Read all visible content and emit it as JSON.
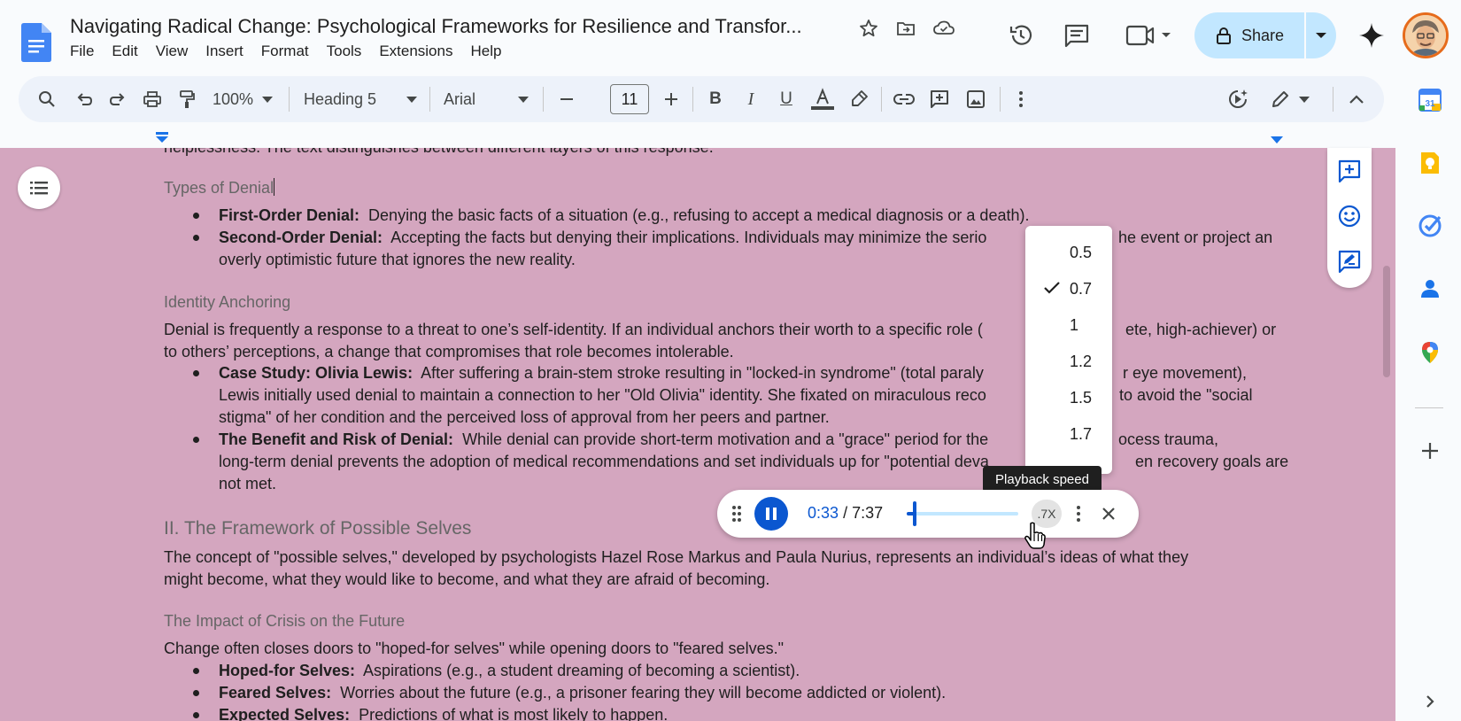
{
  "app": {
    "doc_title": "Navigating Radical Change: Psychological Frameworks for Resilience and Transfor...",
    "menu": [
      "File",
      "Edit",
      "View",
      "Insert",
      "Format",
      "Tools",
      "Extensions",
      "Help"
    ],
    "share_label": "Share"
  },
  "toolbar": {
    "zoom": "100%",
    "style": "Heading 5",
    "font": "Arial",
    "font_size": "11"
  },
  "document": {
    "cut_line": "helplessness. The text distinguishes between different layers of this response.",
    "h_types_of_denial": "Types of Denial",
    "b1_bold": "First-Order Denial:",
    "b1_text": "Denying the basic facts of a situation (e.g., refusing to accept a medical diagnosis or a death).",
    "b2_bold": "Second-Order Denial:",
    "b2_text_l1": "Accepting the facts but denying their implications. Individuals may minimize the serio",
    "b2_text_l1_tail": "he event or project an",
    "b2_text_l2": "overly optimistic future that ignores the new reality.",
    "h_identity": "Identity Anchoring",
    "p_identity_l1": "Denial is frequently a response to a threat to one’s self-identity. If an individual anchors their worth to a specific role (",
    "p_identity_l1_tail": "ete, high-achiever) or",
    "p_identity_l2": "to others’ perceptions, a change that compromises that role becomes intolerable.",
    "b3_bold": "Case Study: Olivia Lewis:",
    "b3_l1": "After suffering a brain-stem stroke resulting in \"locked-in syndrome\" (total paraly",
    "b3_l1_tail": "r eye movement),",
    "b3_l2": "Lewis initially used denial to maintain a connection to her \"Old Olivia\" identity. She fixated on miraculous reco",
    "b3_l2_tail": "to avoid the \"social",
    "b3_l3": "stigma\" of her condition and the perceived loss of approval from her peers and partner.",
    "b4_bold": "The Benefit and Risk of Denial:",
    "b4_l1": "While denial can provide short-term motivation and a \"grace\" period for the",
    "b4_l1_tail": "ocess trauma,",
    "b4_l2": "long-term denial prevents the adoption of medical recommendations and set individuals up for \"potential deva",
    "b4_l2_tail": "en recovery goals are",
    "b4_l3": "not met.",
    "h2_possible_selves": "II. The Framework of Possible Selves",
    "p_possible_l1": "The concept of \"possible selves,\" developed by psychologists Hazel Rose Markus and Paula Nurius, represents an individual’s ideas of what they",
    "p_possible_l2": "might become, what they would like to become, and what they are afraid of becoming.",
    "h_impact": "The Impact of Crisis on the Future",
    "p_impact": "Change often closes doors to \"hoped-for selves\" while opening doors to \"feared selves.\"",
    "b5_bold": "Hoped-for Selves:",
    "b5_text": "Aspirations (e.g., a student dreaming of becoming a scientist).",
    "b6_bold": "Feared Selves:",
    "b6_text": "Worries about the future (e.g., a prisoner fearing they will become addicted or violent).",
    "b7_bold": "Expected Selves:",
    "b7_text": "Predictions of what is most likely to happen."
  },
  "speed_menu": {
    "options": [
      "0.5",
      "0.7",
      "1",
      "1.2",
      "1.5",
      "1.7"
    ],
    "selected": "0.7",
    "tooltip": "Playback speed"
  },
  "player": {
    "current_time": "0:33",
    "total_time": "/ 7:37",
    "speed_chip": ".7X",
    "progress": 0.07
  },
  "colors": {
    "page_highlight": "#d4a6bf",
    "accent": "#0b57d0",
    "share_bg": "#c2e7ff"
  }
}
